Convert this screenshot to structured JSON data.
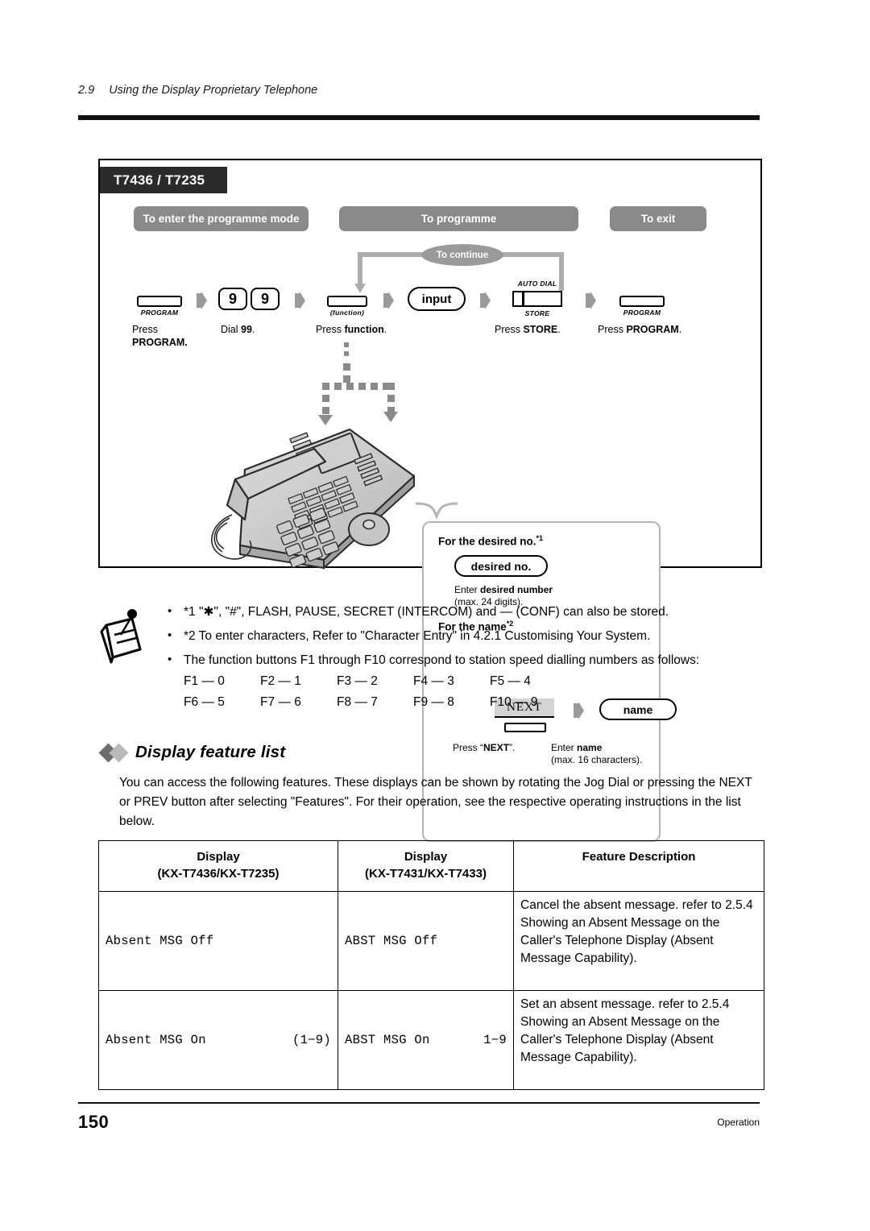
{
  "header": {
    "section_number": "2.9",
    "section_title": "Using the Display Proprietary Telephone"
  },
  "diagram": {
    "device_tag": "T7436 / T7235",
    "phases": {
      "enter": "To enter the programme mode",
      "programme": "To programme",
      "exit": "To exit"
    },
    "continue_label": "To continue",
    "steps": [
      {
        "key_label": "PROGRAM",
        "caption_line1": "Press",
        "caption_line2": "PROGRAM."
      },
      {
        "digit1": "9",
        "digit2": "9",
        "caption": "Dial ",
        "caption_bold": "99",
        "caption_end": "."
      },
      {
        "key_label": "(function)",
        "caption": "Press ",
        "caption_bold": "function",
        "caption_end": "."
      },
      {
        "pill_label": "input"
      },
      {
        "key_label_top": "AUTO DIAL",
        "key_label_bottom": "STORE",
        "caption": "Press ",
        "caption_bold": "STORE",
        "caption_end": "."
      },
      {
        "key_label": "PROGRAM",
        "caption": "Press ",
        "caption_bold": "PROGRAM",
        "caption_end": "."
      }
    ],
    "infobox": {
      "desired_title": "For the desired no.",
      "desired_sup": "*1",
      "desired_pill": "desired no.",
      "desired_text_a": "Enter ",
      "desired_text_bold": "desired number",
      "desired_text_b": "(max. 24 digits).",
      "name_title": "For the name",
      "name_sup": "*2",
      "next_key": "NEXT",
      "name_pill": "name",
      "press_next_a": "Press “",
      "press_next_bold": "NEXT",
      "press_next_b": "”.",
      "enter_name_a": "Enter ",
      "enter_name_bold": "name",
      "enter_name_b": "(max. 16 characters)."
    }
  },
  "notes": [
    "*1 \"✱\", \"#\", FLASH, PAUSE, SECRET (INTERCOM) and — (CONF) can also be stored.",
    "*2 To enter characters, Refer to \"Character Entry\" in 4.2.1   Customising Your System.",
    "The function buttons F1 through F10 correspond to station speed dialling numbers as follows:"
  ],
  "function_map": [
    "F1 — 0",
    "F2 — 1",
    "F3 — 2",
    "F4 — 3",
    "F5 — 4",
    "F6 — 5",
    "F7 — 6",
    "F8 — 7",
    "F9 — 8",
    "F10 — 9"
  ],
  "section": {
    "heading": "Display feature list",
    "body": "You can access the following features. These displays can be shown by rotating the Jog Dial or pressing the NEXT or PREV button after selecting \"Features\". For their operation, see the respective operating instructions in the list below."
  },
  "table": {
    "headers": [
      {
        "line1": "Display",
        "line2": "(KX-T7436/KX-T7235)"
      },
      {
        "line1": "Display",
        "line2": "(KX-T7431/KX-T7433)"
      },
      {
        "line1": "Feature Description",
        "line2": ""
      }
    ],
    "rows": [
      {
        "display_a": "Absent MSG Off",
        "display_a_right": "",
        "display_b": "ABST MSG Off",
        "display_b_right": "",
        "description": "Cancel the absent message. refer to 2.5.4   Showing an Absent Message on the Caller's Telephone Display (Absent Message Capability)."
      },
      {
        "display_a": "Absent MSG On",
        "display_a_right": "(1−9)",
        "display_b": "ABST MSG On",
        "display_b_right": "1−9",
        "description": "Set an absent message. refer to 2.5.4   Showing an Absent Message on the Caller's Telephone Display (Absent Message Capability)."
      }
    ]
  },
  "footer": {
    "page_number": "150",
    "label": "Operation"
  }
}
